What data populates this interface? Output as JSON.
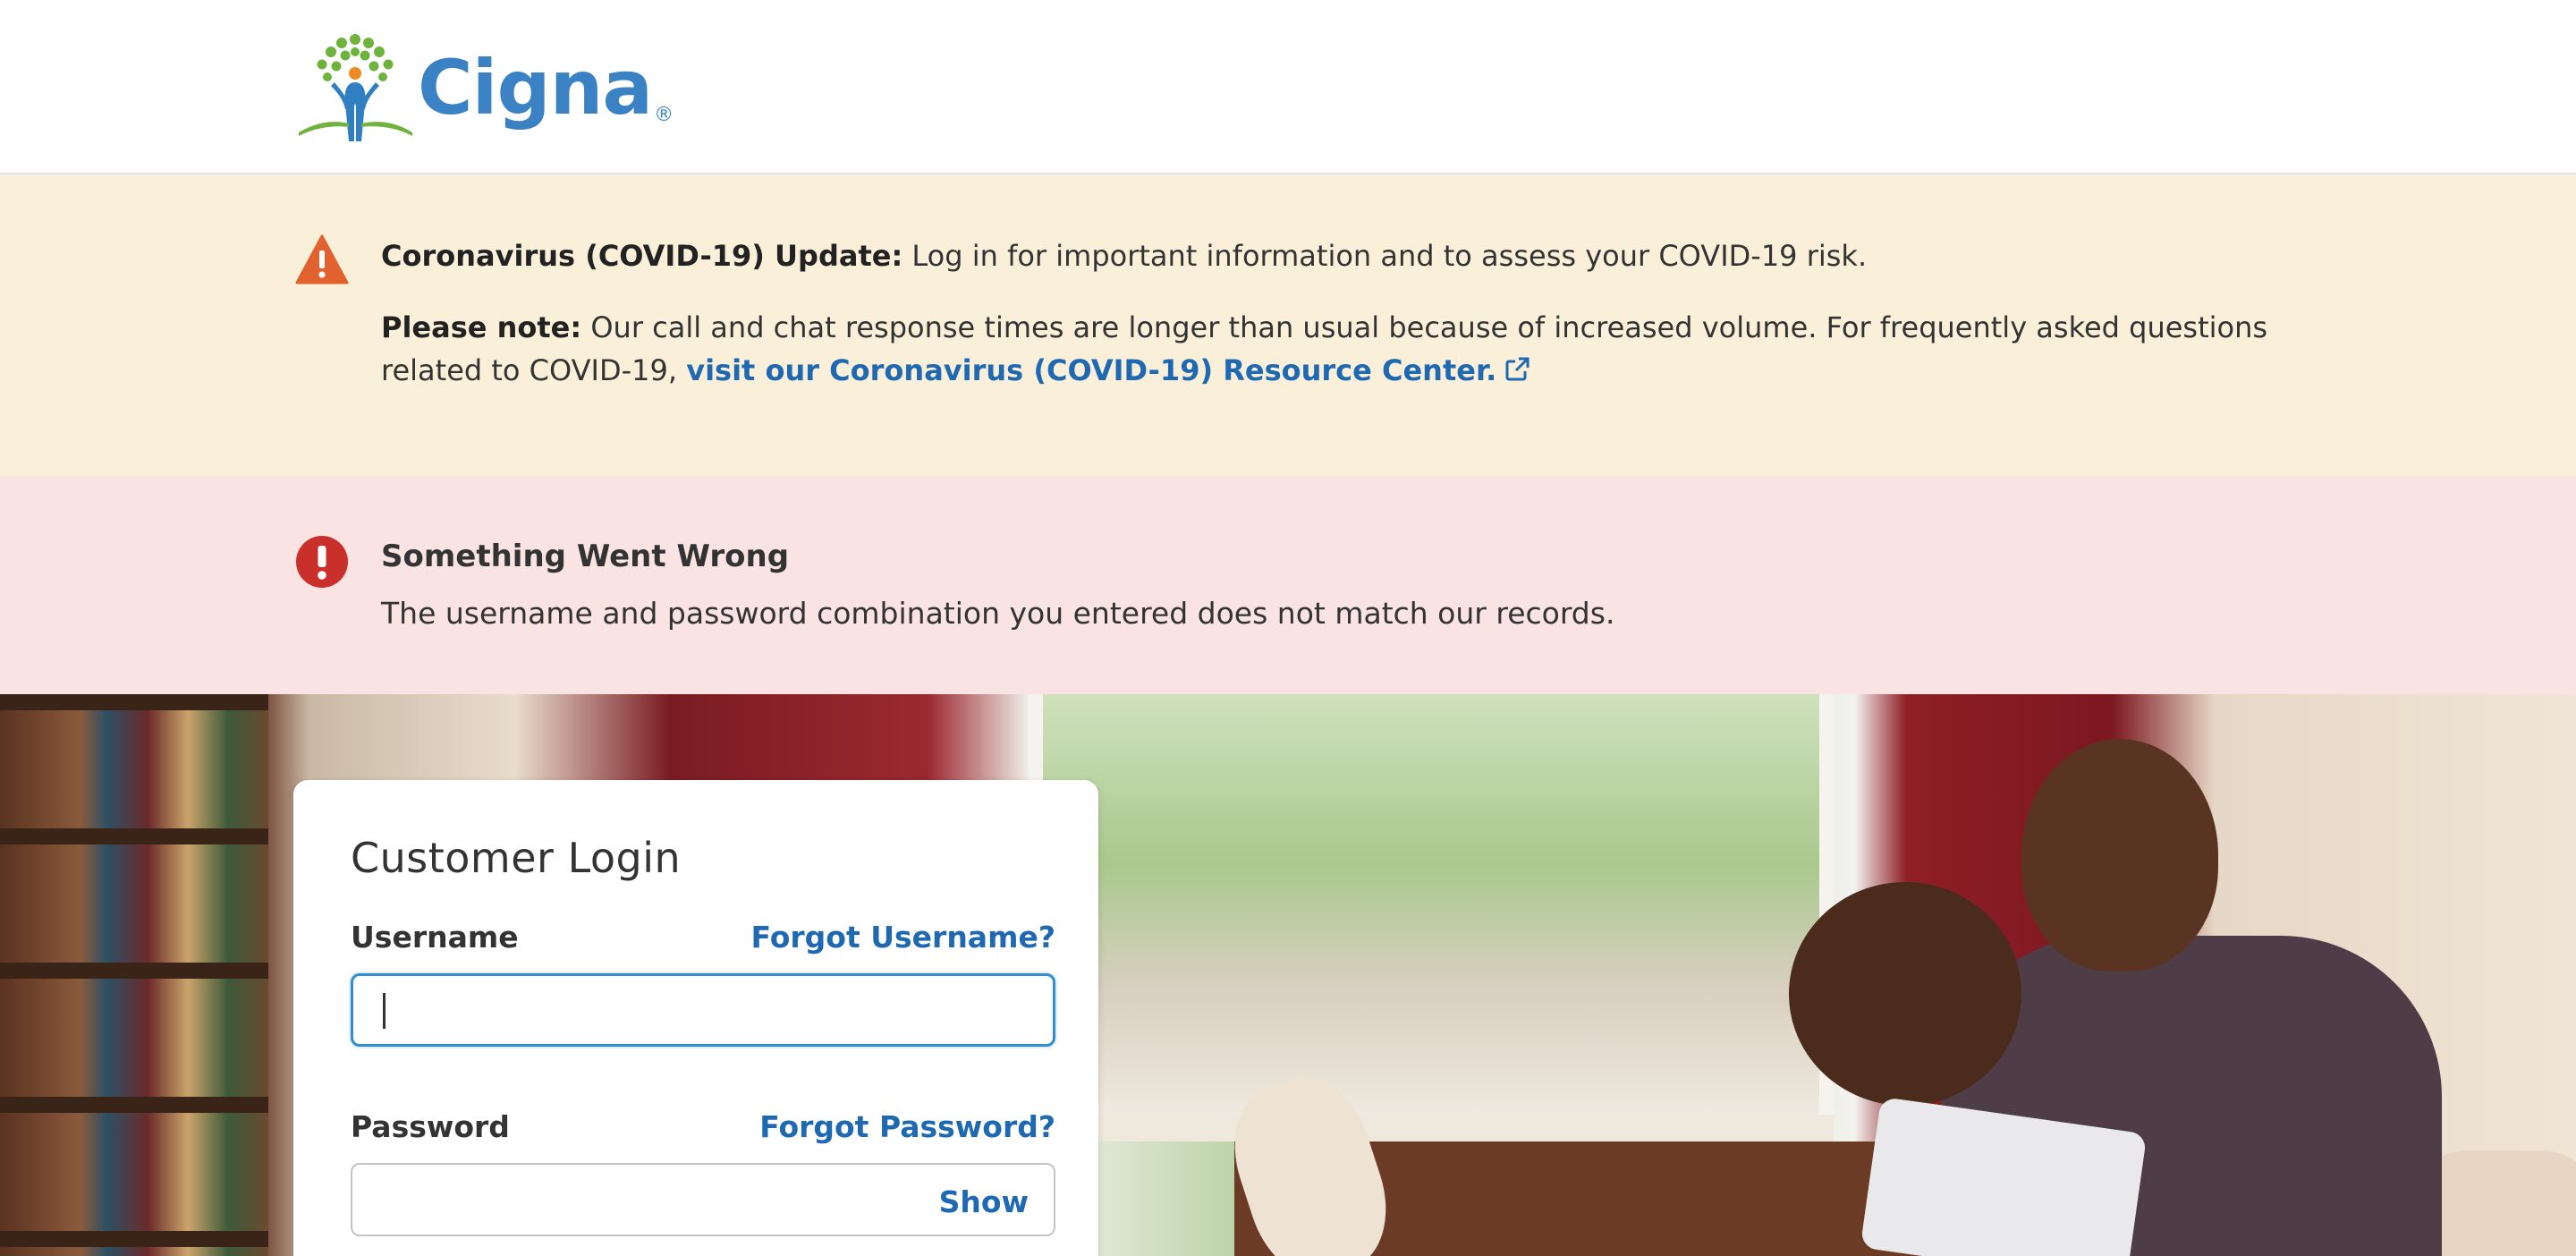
{
  "header": {
    "logo_text": "Cigna",
    "logo_registered": "®"
  },
  "covid_banner": {
    "title_bold": "Coronavirus (COVID-19) Update:",
    "title_text": " Log in for important information and to assess your COVID-19 risk.",
    "note_bold": "Please note:",
    "note_text": " Our call and chat response times are longer than usual because of increased volume. For frequently asked questions related to COVID-19, ",
    "link_text": "visit our Coronavirus (COVID-19) Resource Center.",
    "icon": "warning-triangle-icon",
    "colors": {
      "background": "#faf0da",
      "icon": "#e1622f",
      "link": "#1f69b3"
    }
  },
  "error_banner": {
    "title": "Something Went Wrong",
    "message": "The username and password combination you entered does not match our records.",
    "icon": "error-exclamation-icon",
    "colors": {
      "background": "#f9e3e3",
      "icon": "#c9302c"
    }
  },
  "login": {
    "title": "Customer Login",
    "username_label": "Username",
    "forgot_username": "Forgot Username?",
    "username_value": "",
    "password_label": "Password",
    "forgot_password": "Forgot Password?",
    "password_value": "",
    "show_label": "Show"
  }
}
